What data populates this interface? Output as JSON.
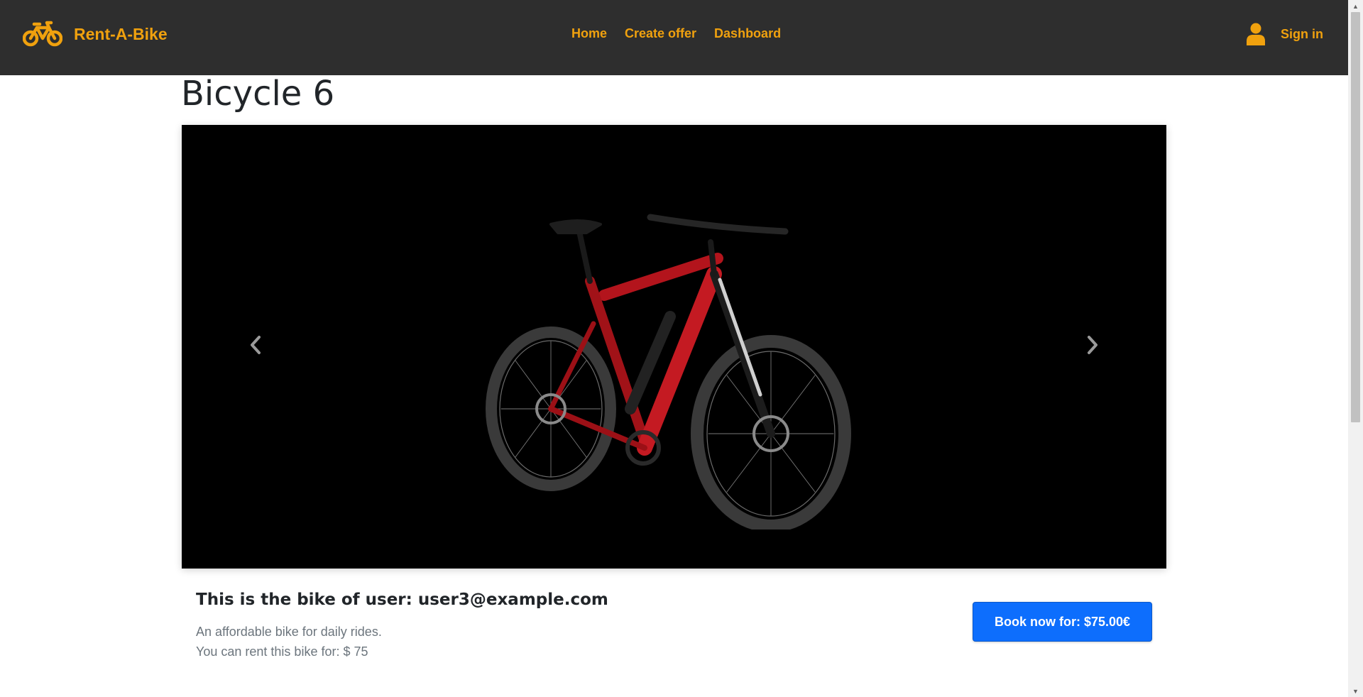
{
  "navbar": {
    "brand": "Rent-A-Bike",
    "links": [
      "Home",
      "Create offer",
      "Dashboard"
    ],
    "signin": "Sign in",
    "accent_color": "#f0a10e",
    "background_color": "#2e2e2e"
  },
  "page": {
    "title": "Bicycle 6"
  },
  "carousel": {
    "image": "red-mountain-ebike",
    "prev_icon": "chevron-left-icon",
    "next_icon": "chevron-right-icon"
  },
  "details": {
    "owner_line": "This is the bike of user: user3@example.com",
    "description": "An affordable bike for daily rides.",
    "price_line": "You can rent this bike for: $ 75"
  },
  "booking": {
    "button_label": "Book now for: $75.00€",
    "button_color": "#0d6efd"
  }
}
